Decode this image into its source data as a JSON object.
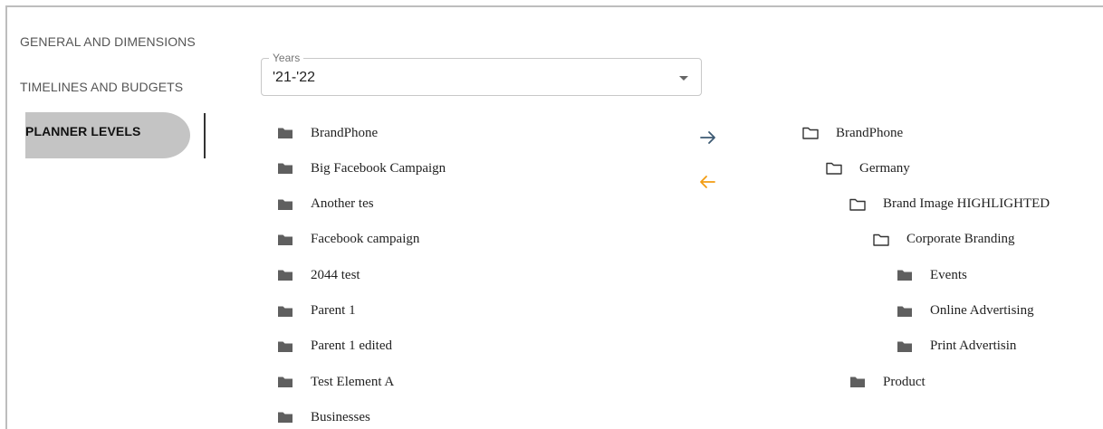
{
  "nav": {
    "items": [
      {
        "label": "GENERAL AND DIMENSIONS",
        "active": false
      },
      {
        "label": "TIMELINES AND BUDGETS",
        "active": false
      },
      {
        "label": "PLANNER LEVELS",
        "active": true
      }
    ]
  },
  "years_select": {
    "label": "Years",
    "value": "'21-'22"
  },
  "available_list": [
    {
      "label": "BrandPhone",
      "icon": "folder-filled-icon"
    },
    {
      "label": "Big Facebook Campaign",
      "icon": "folder-filled-icon"
    },
    {
      "label": "Another tes",
      "icon": "folder-filled-icon"
    },
    {
      "label": "Facebook campaign",
      "icon": "folder-filled-icon"
    },
    {
      "label": "2044 test",
      "icon": "folder-filled-icon"
    },
    {
      "label": "Parent 1",
      "icon": "folder-filled-icon"
    },
    {
      "label": "Parent 1 edited",
      "icon": "folder-filled-icon"
    },
    {
      "label": "Test Element A",
      "icon": "folder-filled-icon"
    },
    {
      "label": "Businesses",
      "icon": "folder-filled-icon"
    }
  ],
  "transfer": {
    "move_right_icon": "arrow-right-icon",
    "move_left_icon": "arrow-left-icon",
    "move_right_color": "#3d5a73",
    "move_left_color": "#f39c12"
  },
  "selected_tree": [
    {
      "label": "BrandPhone",
      "depth": 0,
      "icon": "folder-outline-icon"
    },
    {
      "label": "Germany",
      "depth": 1,
      "icon": "folder-outline-icon"
    },
    {
      "label": "Brand Image HIGHLIGHTED",
      "depth": 2,
      "icon": "folder-outline-icon"
    },
    {
      "label": "Corporate Branding",
      "depth": 3,
      "icon": "folder-outline-icon"
    },
    {
      "label": "Events",
      "depth": 4,
      "icon": "folder-filled-icon"
    },
    {
      "label": "Online Advertising",
      "depth": 4,
      "icon": "folder-filled-icon"
    },
    {
      "label": "Print Advertisin",
      "depth": 4,
      "icon": "folder-filled-icon"
    },
    {
      "label": "Product",
      "depth": 2,
      "icon": "folder-filled-icon"
    }
  ],
  "colors": {
    "folder": "#5f5f5f",
    "nav_active_bg": "#c4c4c4"
  }
}
